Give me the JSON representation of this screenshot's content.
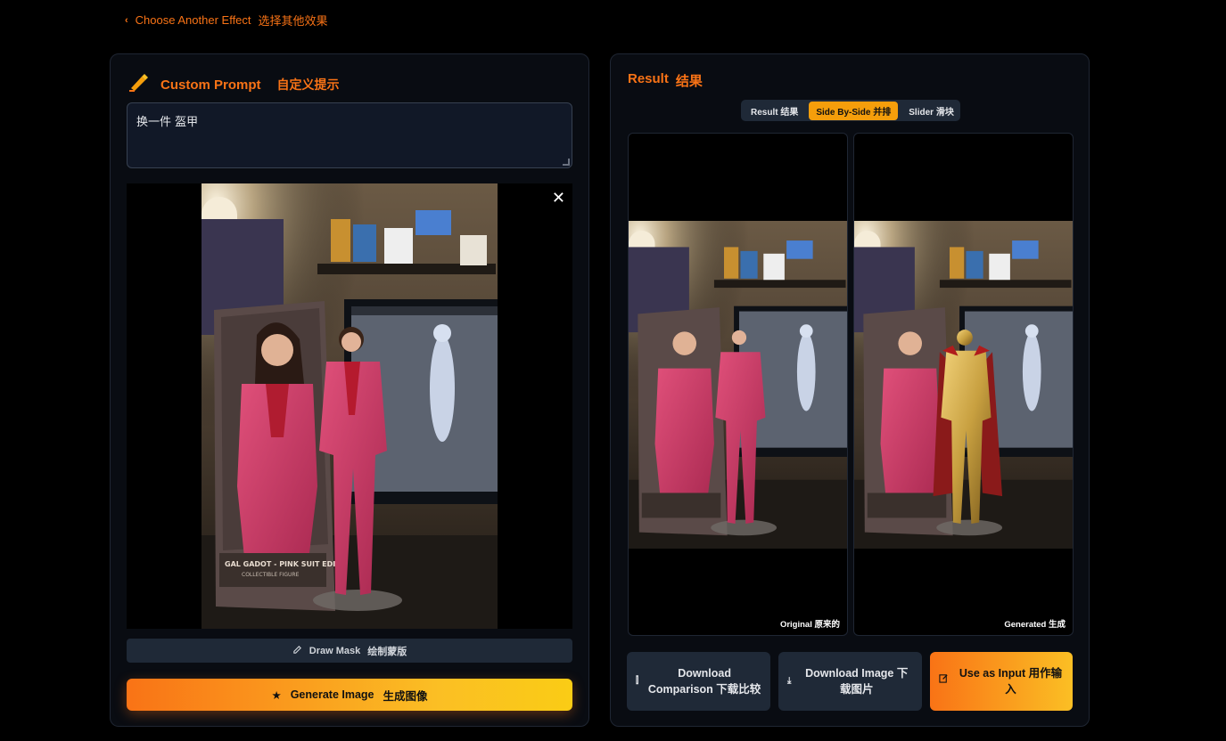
{
  "nav": {
    "back_label": "Choose Another Effect",
    "back_label_cn": "选择其他效果"
  },
  "prompt": {
    "title": "Custom Prompt",
    "title_cn": "自定义提示",
    "value": "换一件 盔甲"
  },
  "mask": {
    "label": "Draw Mask",
    "label_cn": "绘制蒙版"
  },
  "generate": {
    "label": "Generate Image",
    "label_cn": "生成图像"
  },
  "result": {
    "title": "Result",
    "title_cn": "结果",
    "tabs": [
      {
        "label": "Result  结果",
        "active": false
      },
      {
        "label": "Side By-Side  并排",
        "active": true
      },
      {
        "label": "Slider  滑块",
        "active": false
      }
    ],
    "original_label": "Original  原来的",
    "generated_label": "Generated  生成"
  },
  "actions": {
    "download_comparison": "Download Comparison 下载比较",
    "download_image": "Download Image 下载图片",
    "use_as_input": "Use as Input 用作输入"
  },
  "icons": {
    "back": "chevron-left-icon",
    "pen": "writing-hand-icon",
    "close": "close-icon",
    "pencil": "pencil-icon",
    "star": "star-icon",
    "compare": "compare-icon",
    "download": "download-icon",
    "edit": "edit-icon"
  },
  "colors": {
    "accent": "#f97316",
    "accent_light": "#facc15",
    "panel": "#090c12",
    "control": "#1f2937"
  }
}
